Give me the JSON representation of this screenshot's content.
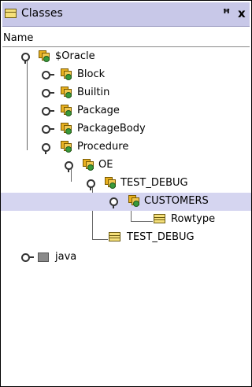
{
  "panel": {
    "title": "Classes",
    "pin_glyph": "ꟸ",
    "close_glyph": "x",
    "column_header": "Name"
  },
  "tree": {
    "oracle": "$Oracle",
    "block": "Block",
    "builtin": "Builtin",
    "package": "Package",
    "package_body": "PackageBody",
    "procedure": "Procedure",
    "oe": "OE",
    "test_debug_pkg": "TEST_DEBUG",
    "customers": "CUSTOMERS",
    "rowtype": "Rowtype",
    "test_debug_type": "TEST_DEBUG",
    "java": "java"
  },
  "colors": {
    "titlebar": "#c8c8e8",
    "selection": "#d5d5f0"
  }
}
